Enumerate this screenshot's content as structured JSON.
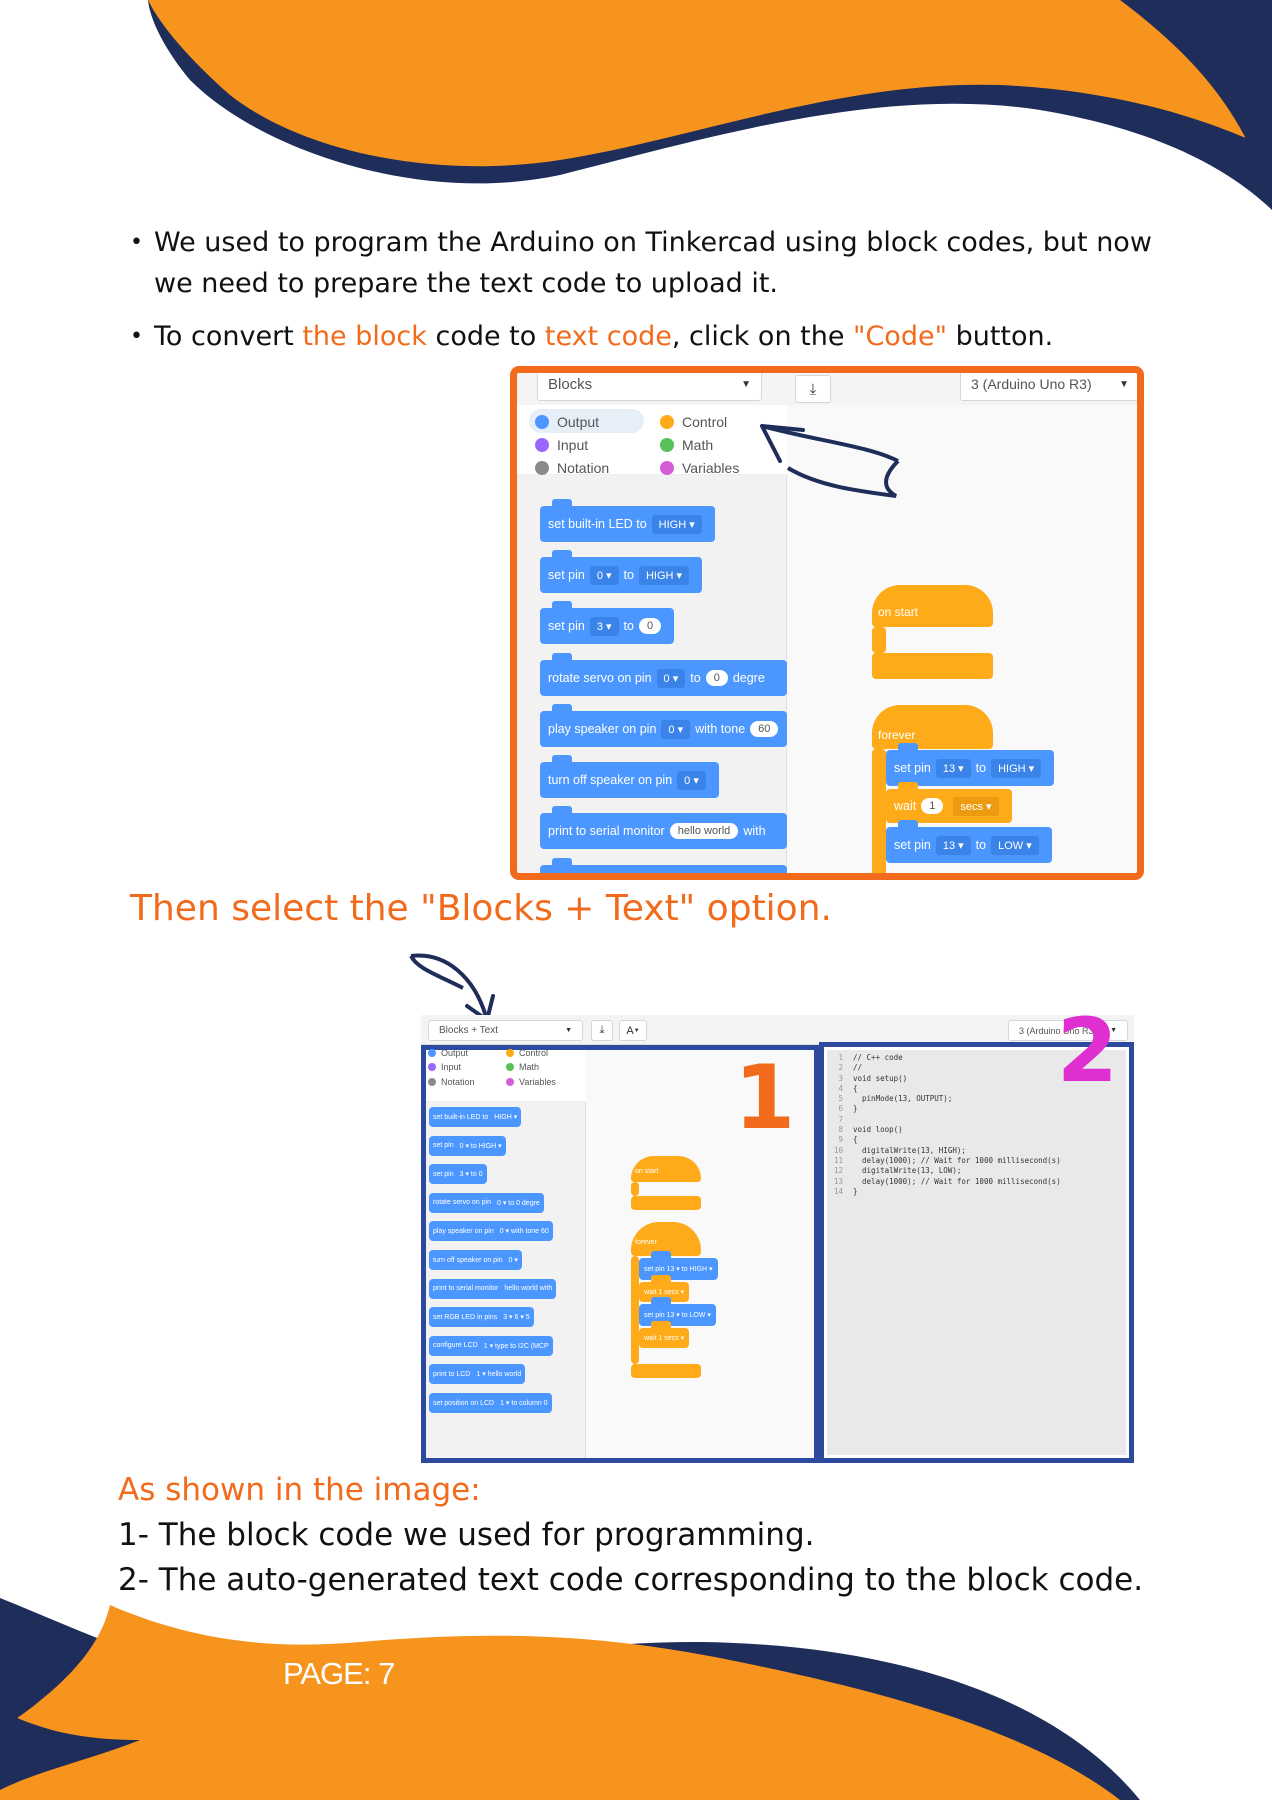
{
  "bullets": {
    "b1": "We used to program the Arduino on Tinkercad using block codes, but now we need to prepare the text code to upload it.",
    "b2_part1": "To convert ",
    "b2_part2": "the block",
    "b2_part3": " code to ",
    "b2_part4": "text code",
    "b2_part5": ", click on the ",
    "b2_part6": "\"Code\"",
    "b2_part7": " button."
  },
  "screenshot1": {
    "mode_select": "Blocks",
    "board_select": "3 (Arduino Uno R3)",
    "categories": [
      {
        "label": "Output",
        "color": "#4c97ff"
      },
      {
        "label": "Control",
        "color": "#ffab19"
      },
      {
        "label": "Input",
        "color": "#9966ff"
      },
      {
        "label": "Math",
        "color": "#59c059"
      },
      {
        "label": "Notation",
        "color": "#8a8a8a"
      },
      {
        "label": "Variables",
        "color": "#d65cd6"
      }
    ],
    "blocks": {
      "b1": {
        "text": "set built-in LED to",
        "val": "HIGH"
      },
      "b2": {
        "text": "set pin",
        "pin": "0",
        "to": "to",
        "val": "HIGH"
      },
      "b3": {
        "text": "set pin",
        "pin": "3",
        "to": "to",
        "val": "0"
      },
      "b4": {
        "text": "rotate servo on pin",
        "pin": "0",
        "to": "to",
        "val": "0",
        "tail": "degre"
      },
      "b5": {
        "text": "play speaker on pin",
        "pin": "0",
        "mid": "with tone",
        "val": "60"
      },
      "b6": {
        "text": "turn off speaker on pin",
        "pin": "0"
      },
      "b7": {
        "text": "print to serial monitor",
        "val": "hello world",
        "tail": "with"
      }
    },
    "canvas": {
      "on_start": "on start",
      "forever": "forever",
      "s1_text": "set pin",
      "s1_pin": "13",
      "s1_to": "to",
      "s1_val": "HIGH",
      "w1_text": "wait",
      "w1_val": "1",
      "w1_unit": "secs",
      "s2_text": "set pin",
      "s2_pin": "13",
      "s2_to": "to",
      "s2_val": "LOW"
    }
  },
  "then_title": "Then select the \"Blocks + Text\" option.",
  "screenshot2": {
    "mode_select": "Blocks + Text",
    "font_btn": "A",
    "board_select": "3 (Arduino Uno R3)",
    "categories": [
      {
        "label": "Output",
        "color": "#4c97ff"
      },
      {
        "label": "Control",
        "color": "#ffab19"
      },
      {
        "label": "Input",
        "color": "#9966ff"
      },
      {
        "label": "Math",
        "color": "#59c059"
      },
      {
        "label": "Notation",
        "color": "#8a8a8a"
      },
      {
        "label": "Variables",
        "color": "#d65cd6"
      }
    ],
    "blocks": [
      {
        "text": "set built-in LED to",
        "rest": "HIGH ▾"
      },
      {
        "text": "set pin",
        "rest": "0 ▾  to  HIGH ▾"
      },
      {
        "text": "set pin",
        "rest": "3 ▾  to  0"
      },
      {
        "text": "rotate servo on pin",
        "rest": "0 ▾  to  0  degre"
      },
      {
        "text": "play speaker on pin",
        "rest": "0 ▾  with tone  60"
      },
      {
        "text": "turn off speaker on pin",
        "rest": "0 ▾"
      },
      {
        "text": "print to serial monitor",
        "rest": "hello world  with"
      },
      {
        "text": "set RGB LED in pins",
        "rest": "3 ▾  6 ▾  5"
      },
      {
        "text": "configure LCD",
        "rest": "1 ▾  type to  I2C (MCP"
      },
      {
        "text": "print to LCD",
        "rest": "1 ▾  hello world"
      },
      {
        "text": "set position on LCD",
        "rest": "1 ▾  to column  0"
      }
    ],
    "canvas": {
      "on_start": "on start",
      "forever": "forever",
      "s1": "set pin  13 ▾  to  HIGH ▾",
      "w1": "wait  1  secs ▾",
      "s2": "set pin  13 ▾  to  LOW ▾",
      "w2": "wait  1  secs ▾"
    },
    "code_lines": [
      {
        "n": "1",
        "t": "// C++ code"
      },
      {
        "n": "2",
        "t": "//"
      },
      {
        "n": "3",
        "t": "void setup()"
      },
      {
        "n": "4",
        "t": "{"
      },
      {
        "n": "5",
        "t": "  pinMode(13, OUTPUT);"
      },
      {
        "n": "6",
        "t": "}"
      },
      {
        "n": "7",
        "t": ""
      },
      {
        "n": "8",
        "t": "void loop()"
      },
      {
        "n": "9",
        "t": "{"
      },
      {
        "n": "10",
        "t": "  digitalWrite(13, HIGH);"
      },
      {
        "n": "11",
        "t": "  delay(1000); // Wait for 1000 millisecond(s)"
      },
      {
        "n": "12",
        "t": "  digitalWrite(13, LOW);"
      },
      {
        "n": "13",
        "t": "  delay(1000); // Wait for 1000 millisecond(s)"
      },
      {
        "n": "14",
        "t": "}"
      }
    ],
    "label1": "1",
    "label2": "2",
    "frame_color": "#2c4a9e"
  },
  "shown_title": "As shown in the image:",
  "item1": "1- The block code we used for programming.",
  "item2": "2- The auto-generated text code corresponding to the block code.",
  "page_label": "PAGE: 7",
  "colors": {
    "orange": "#f7941d",
    "navy": "#1f2d5a",
    "accent": "#f26a1b"
  }
}
